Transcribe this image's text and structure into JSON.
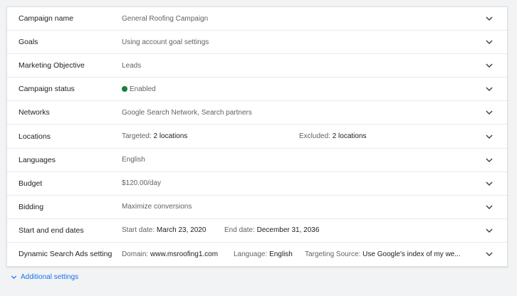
{
  "colors": {
    "enabled_dot": "#188038",
    "link": "#1a73e8",
    "chevron": "#3c4043"
  },
  "icons": {
    "row_expand": "chevron-down-icon",
    "additional": "chevron-down-icon"
  },
  "settings": {
    "campaign_name": {
      "label": "Campaign name",
      "value": "General Roofing Campaign"
    },
    "goals": {
      "label": "Goals",
      "value": "Using account goal settings"
    },
    "marketing_objective": {
      "label": "Marketing Objective",
      "value": "Leads"
    },
    "campaign_status": {
      "label": "Campaign status",
      "value": "Enabled"
    },
    "networks": {
      "label": "Networks",
      "value": "Google Search Network, Search partners"
    },
    "locations": {
      "label": "Locations",
      "targeted_label": "Targeted:",
      "targeted_value": "2 locations",
      "excluded_label": "Excluded:",
      "excluded_value": "2 locations"
    },
    "languages": {
      "label": "Languages",
      "value": "English"
    },
    "budget": {
      "label": "Budget",
      "value": "$120.00/day"
    },
    "bidding": {
      "label": "Bidding",
      "value": "Maximize conversions"
    },
    "dates": {
      "label": "Start and end dates",
      "start_label": "Start date:",
      "start_value": "March 23, 2020",
      "end_label": "End date:",
      "end_value": "December 31, 2036"
    },
    "dsa": {
      "label": "Dynamic Search Ads setting",
      "domain_label": "Domain:",
      "domain_value": "www.msroofing1.com",
      "language_label": "Language:",
      "language_value": "English",
      "source_label": "Targeting Source:",
      "source_value": "Use Google's index of my we..."
    }
  },
  "additional_settings": {
    "label": "Additional settings"
  }
}
